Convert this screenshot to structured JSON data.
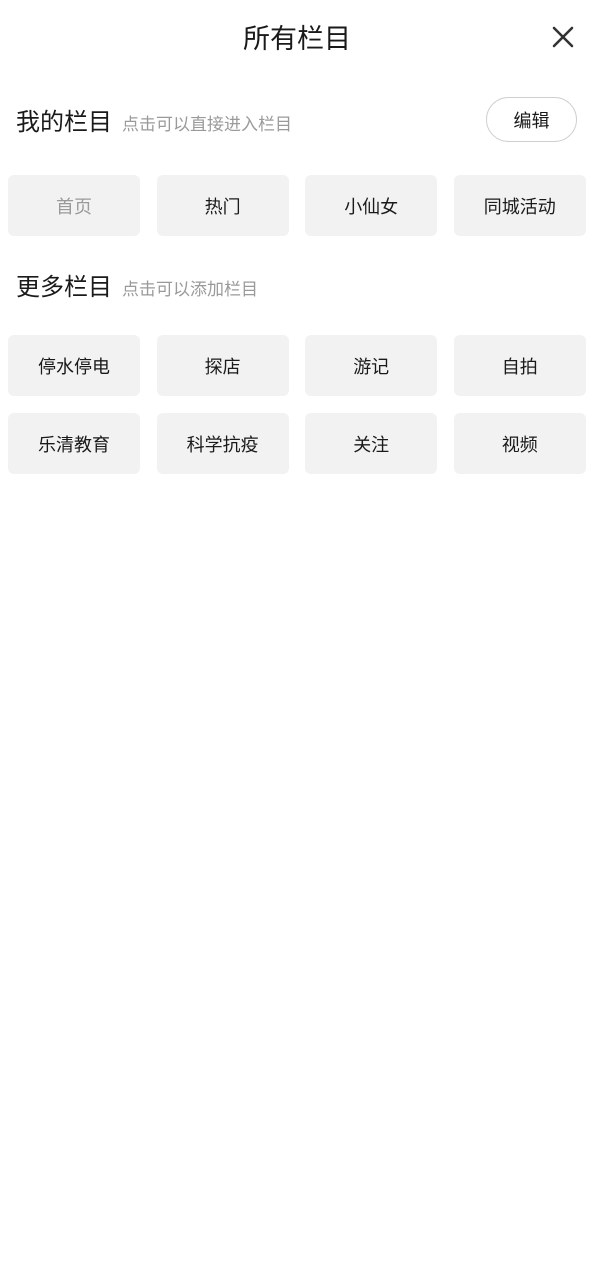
{
  "header": {
    "title": "所有栏目",
    "close_icon": "close-icon"
  },
  "my_channels": {
    "title": "我的栏目",
    "hint": "点击可以直接进入栏目",
    "edit_label": "编辑",
    "items": [
      {
        "label": "首页",
        "fixed": true
      },
      {
        "label": "热门",
        "fixed": false
      },
      {
        "label": "小仙女",
        "fixed": false
      },
      {
        "label": "同城活动",
        "fixed": false
      }
    ]
  },
  "more_channels": {
    "title": "更多栏目",
    "hint": "点击可以添加栏目",
    "items": [
      {
        "label": "停水停电"
      },
      {
        "label": "探店"
      },
      {
        "label": "游记"
      },
      {
        "label": "自拍"
      },
      {
        "label": "乐清教育"
      },
      {
        "label": "科学抗疫"
      },
      {
        "label": "关注"
      },
      {
        "label": "视频"
      }
    ]
  },
  "colors": {
    "chip_bg": "#f2f2f2",
    "hint_text": "#9a9a9a",
    "primary_text": "#1a1a1a"
  }
}
